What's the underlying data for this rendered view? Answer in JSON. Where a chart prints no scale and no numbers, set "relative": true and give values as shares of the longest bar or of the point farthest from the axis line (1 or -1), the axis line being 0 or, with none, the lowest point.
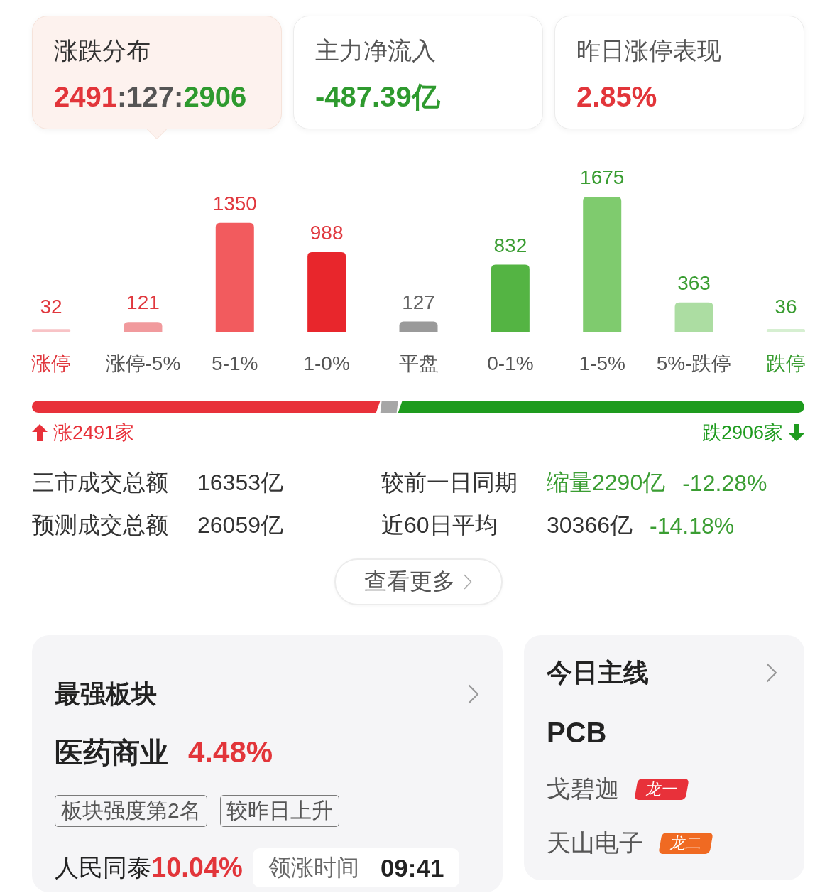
{
  "summary_cards": [
    {
      "title": "涨跌分布",
      "selected": true,
      "value_parts": [
        {
          "text": "2491",
          "color": "#e2353a"
        },
        {
          "text": ":127:",
          "color": "#555555"
        },
        {
          "text": "2906",
          "color": "#2e9a2e"
        }
      ]
    },
    {
      "title": "主力净流入",
      "selected": false,
      "value_parts": [
        {
          "text": "-487.39亿",
          "color": "#2e9a2e"
        }
      ]
    },
    {
      "title": "昨日涨停表现",
      "selected": false,
      "value_parts": [
        {
          "text": "2.85%",
          "color": "#e2353a"
        }
      ]
    }
  ],
  "distribution": {
    "chart_data": {
      "type": "bar",
      "categories": [
        "涨停",
        "涨停-5%",
        "5-1%",
        "1-0%",
        "平盘",
        "0-1%",
        "1-5%",
        "5%-跌停",
        "跌停"
      ],
      "series": [
        {
          "values": [
            32,
            121,
            1350,
            988,
            127,
            832,
            1675,
            363,
            36
          ]
        }
      ],
      "data_labels": true
    },
    "bars": [
      {
        "color": "#f8c3c6"
      },
      {
        "color": "#f19a9d"
      },
      {
        "color": "#f25b5e"
      },
      {
        "color": "#e8262c"
      },
      {
        "color": "#9a9a9a"
      },
      {
        "color": "#54b443"
      },
      {
        "color": "#7fcb6e"
      },
      {
        "color": "#acdda2"
      },
      {
        "color": "#d6efd1"
      }
    ]
  },
  "breadth": {
    "chart_data": {
      "type": "bar",
      "orientation": "horizontal",
      "stacked": true,
      "relative": true,
      "series": [
        {
          "color": "#e8313a",
          "values": [
            0.451
          ]
        },
        {
          "color": "#a6a6a6",
          "values": [
            0.023
          ]
        },
        {
          "color": "#1e9b1e",
          "values": [
            0.526
          ]
        }
      ]
    },
    "up_label": "涨2491家",
    "down_label": "跌2906家"
  },
  "turnover": [
    {
      "label": "三市成交总额",
      "value": "16353亿",
      "compare_label": "较前一日同期",
      "compare_parts": [
        {
          "text": "缩量2290亿",
          "color": "#3a9d32"
        },
        {
          "text": "-12.28%",
          "color": "#3a9d32"
        }
      ]
    },
    {
      "label": "预测成交总额",
      "value": "26059亿",
      "compare_label": "近60日平均",
      "compare_parts": [
        {
          "text": "30366亿",
          "color": "#333333"
        },
        {
          "text": "-14.18%",
          "color": "#3a9d32"
        }
      ]
    }
  ],
  "more_button": {
    "label": "查看更多"
  },
  "strongest_sector": {
    "title": "最强板块",
    "name": "医药商业",
    "change": "4.48%",
    "tags": [
      "板块强度第2名",
      "较昨日上升"
    ],
    "leader_name": "人民同泰",
    "leader_change": "10.04%",
    "lead_time_label": "领涨时间",
    "lead_time": "09:41"
  },
  "main_theme": {
    "title": "今日主线",
    "theme": "PCB",
    "stocks": [
      {
        "name": "戈碧迦",
        "badge": "龙一",
        "color": "#e8313a"
      },
      {
        "name": "天山电子",
        "badge": "龙二",
        "color": "#f06a22"
      }
    ]
  }
}
